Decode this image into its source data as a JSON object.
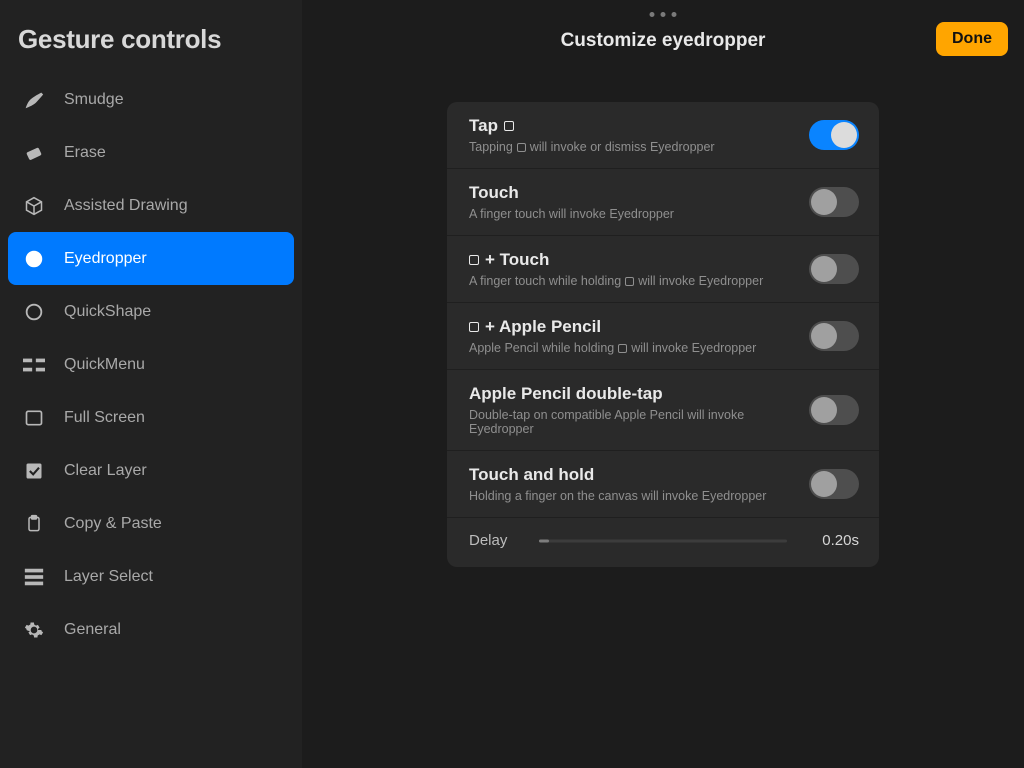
{
  "sidebar": {
    "title": "Gesture controls",
    "items": [
      {
        "id": "smudge",
        "label": "Smudge"
      },
      {
        "id": "erase",
        "label": "Erase"
      },
      {
        "id": "assisted-drawing",
        "label": "Assisted Drawing"
      },
      {
        "id": "eyedropper",
        "label": "Eyedropper"
      },
      {
        "id": "quickshape",
        "label": "QuickShape"
      },
      {
        "id": "quickmenu",
        "label": "QuickMenu"
      },
      {
        "id": "full-screen",
        "label": "Full Screen"
      },
      {
        "id": "clear-layer",
        "label": "Clear Layer"
      },
      {
        "id": "copy-paste",
        "label": "Copy & Paste"
      },
      {
        "id": "layer-select",
        "label": "Layer Select"
      },
      {
        "id": "general",
        "label": "General"
      }
    ],
    "active": "eyedropper"
  },
  "header": {
    "title": "Customize eyedropper",
    "done_label": "Done"
  },
  "options": [
    {
      "id": "tap",
      "title_pre": "Tap ",
      "desc_pre": "Tapping ",
      "desc_post": " will invoke or dismiss Eyedropper",
      "enabled": true,
      "has_square_in_title": true,
      "has_square_in_desc": true
    },
    {
      "id": "touch",
      "title_pre": "Touch",
      "desc_pre": "A finger touch will invoke Eyedropper",
      "desc_post": "",
      "enabled": false,
      "has_square_in_title": false,
      "has_square_in_desc": false
    },
    {
      "id": "square-touch",
      "title_pre": " + Touch",
      "desc_pre": "A finger touch while holding ",
      "desc_post": " will invoke Eyedropper",
      "enabled": false,
      "leading_square_title": true,
      "has_square_in_desc": true
    },
    {
      "id": "square-pencil",
      "title_pre": " + Apple Pencil",
      "desc_pre": "Apple Pencil while holding ",
      "desc_post": " will invoke Eyedropper",
      "enabled": false,
      "leading_square_title": true,
      "has_square_in_desc": true
    },
    {
      "id": "pencil-doubletap",
      "title_pre": "Apple Pencil double-tap",
      "desc_pre": "Double-tap on compatible Apple Pencil will invoke Eyedropper",
      "desc_post": "",
      "enabled": false
    },
    {
      "id": "touch-hold",
      "title_pre": "Touch and hold",
      "desc_pre": "Holding a finger on the canvas will invoke Eyedropper",
      "desc_post": "",
      "enabled": false
    }
  ],
  "delay": {
    "label": "Delay",
    "value": "0.20s",
    "fraction": 0.04
  }
}
